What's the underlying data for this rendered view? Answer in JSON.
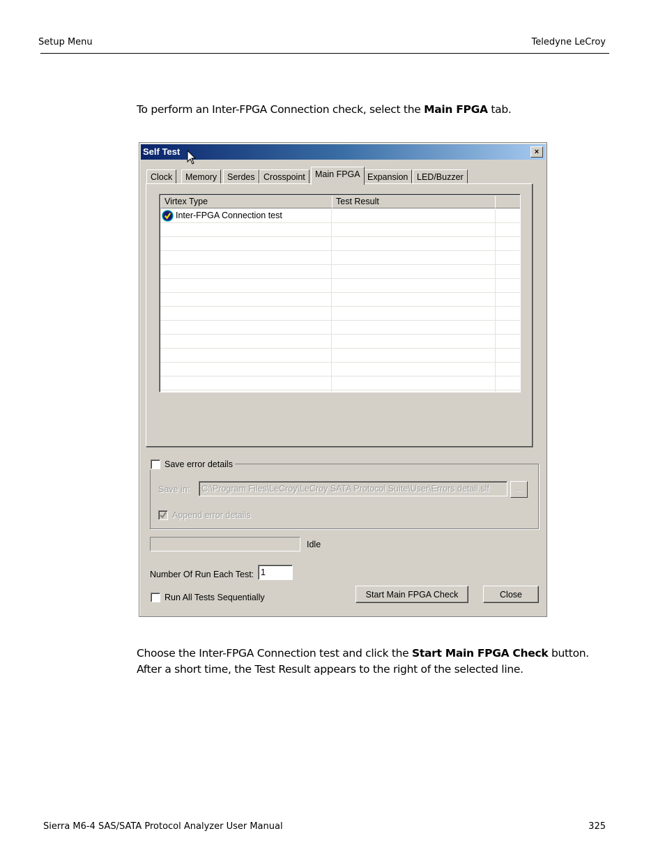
{
  "header": {
    "left": "Setup Menu",
    "right": "Teledyne  LeCroy"
  },
  "intro": {
    "prefix": "To perform an Inter-FPGA Connection check, select the ",
    "bold": "Main FPGA",
    "suffix": " tab."
  },
  "dialog": {
    "title": "Self Test",
    "close_icon": "×",
    "tabs": [
      {
        "label": "Clock"
      },
      {
        "label": "Memory"
      },
      {
        "label": "Serdes"
      },
      {
        "label": "Crosspoint"
      },
      {
        "label": "Main FPGA",
        "active": true
      },
      {
        "label": "Expansion"
      },
      {
        "label": "LED/Buzzer"
      }
    ],
    "list": {
      "columns": [
        "Virtex Type",
        "Test Result",
        ""
      ],
      "rows": [
        {
          "type": "Inter-FPGA Connection test",
          "result": "",
          "icon": "checkmark-badge-icon",
          "checked": true
        }
      ],
      "empty_rows": 12
    },
    "save_error_details": {
      "label": "Save error details",
      "checked": false
    },
    "save_in": {
      "label": "Save in:",
      "value": "C:\\Program Files\\LeCroy\\LeCroy SATA Protocol Suite\\User\\Errors detail.slf",
      "browse_label": "..."
    },
    "append_error_details": {
      "label": "Append error details",
      "checked": true,
      "disabled": true
    },
    "progress": {
      "value": 0
    },
    "status": "Idle",
    "runs": {
      "label": "Number Of Run Each Test:",
      "value": "1"
    },
    "run_all": {
      "label": "Run All Tests Sequentially",
      "checked": false
    },
    "buttons": {
      "start": "Start Main FPGA Check",
      "close": "Close"
    }
  },
  "instructions": {
    "line1_prefix": "Choose the Inter-FPGA Connection test and click the ",
    "line1_bold": "Start Main FPGA Check",
    "line1_suffix": " button.",
    "line2": "After a short time, the Test Result appears to the right of the selected line."
  },
  "footer": {
    "left": "Sierra M6-4 SAS/SATA Protocol Analyzer User Manual",
    "page": "325"
  }
}
